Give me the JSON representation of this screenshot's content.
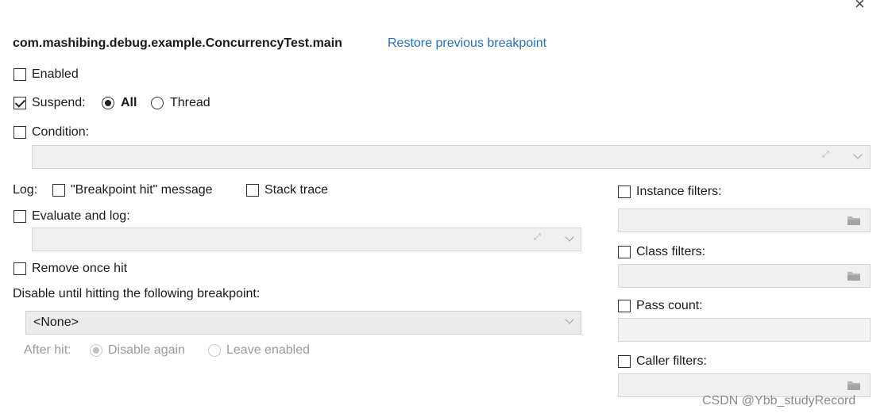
{
  "header": {
    "title": "com.mashibing.debug.example.ConcurrencyTest.main",
    "restore_link": "Restore previous breakpoint",
    "close_glyph": "×"
  },
  "options": {
    "enabled": {
      "label": "Enabled",
      "checked": false
    },
    "suspend": {
      "label": "Suspend:",
      "checked": true
    },
    "suspend_all": {
      "label": "All",
      "selected": true
    },
    "suspend_thread": {
      "label": "Thread",
      "selected": false
    },
    "condition": {
      "label": "Condition:",
      "checked": false,
      "value": ""
    }
  },
  "log": {
    "label": "Log:",
    "breakpoint_hit": {
      "label": "\"Breakpoint hit\" message",
      "checked": false
    },
    "stack_trace": {
      "label": "Stack trace",
      "checked": false
    },
    "evaluate_and_log": {
      "label": "Evaluate and log:",
      "checked": false,
      "value": ""
    }
  },
  "remove_once_hit": {
    "label": "Remove once hit",
    "checked": false
  },
  "disable_until": {
    "label": "Disable until hitting the following breakpoint:",
    "selected": "<None>"
  },
  "after_hit": {
    "label": "After hit:",
    "disable_again": "Disable again",
    "leave_enabled": "Leave enabled",
    "selected": "Disable again"
  },
  "filters": {
    "instance": {
      "label": "Instance filters:",
      "checked": false
    },
    "class": {
      "label": "Class filters:",
      "checked": false
    },
    "pass_count": {
      "label": "Pass count:",
      "checked": false
    },
    "caller": {
      "label": "Caller filters:",
      "checked": false
    }
  },
  "watermark": "CSDN @Ybb_studyRecord"
}
